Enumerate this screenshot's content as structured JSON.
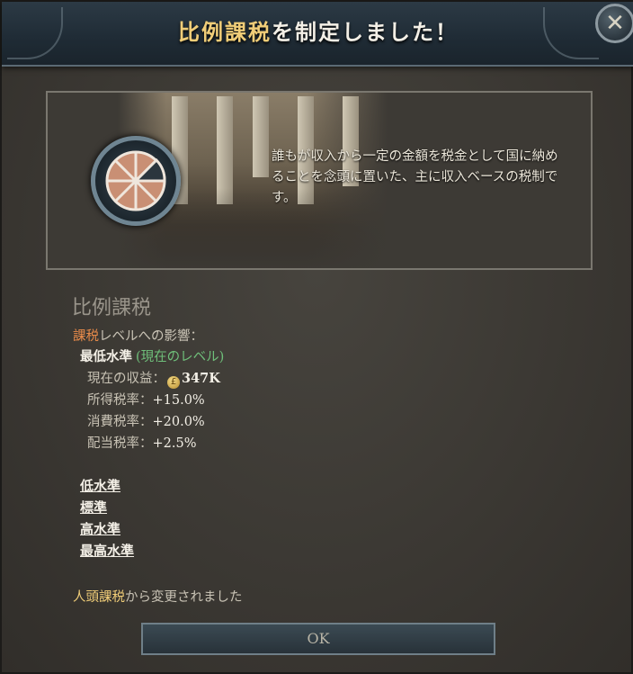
{
  "header": {
    "title_highlight": "比例課税",
    "title_rest": "を制定しました！",
    "close_symbol": "✕"
  },
  "panel": {
    "description": "誰もが収入から一定の金額を税金として国に納めることを念頭に置いた、主に収入ベースの税制です。"
  },
  "details": {
    "tax_name": "比例課税",
    "effect_label_highlight": "課税",
    "effect_label_rest": "レベルへの影響：",
    "current_level": "最低水準",
    "current_level_note": "(現在のレベル)",
    "revenue_label": "現在の収益：",
    "revenue_icon": "£",
    "revenue_value": "347K",
    "rows": [
      {
        "label": "所得税率：",
        "value": "+15.0%"
      },
      {
        "label": "消費税率：",
        "value": "+20.0%"
      },
      {
        "label": "配当税率：",
        "value": "+2.5%"
      }
    ]
  },
  "levels": [
    "低水準",
    "標準",
    "高水準",
    "最高水準"
  ],
  "footer": {
    "changed_highlight": "人頭課税",
    "changed_rest": "から変更されました",
    "ok_label": "OK"
  },
  "colors": {
    "highlight_gold": "#f0cd78",
    "highlight_orange": "#e78a4a",
    "current_green": "#6fbf7a"
  },
  "icons": {
    "close": "close-icon",
    "emblem": "proportional-tax-emblem-icon",
    "currency": "pound-coin-icon"
  }
}
